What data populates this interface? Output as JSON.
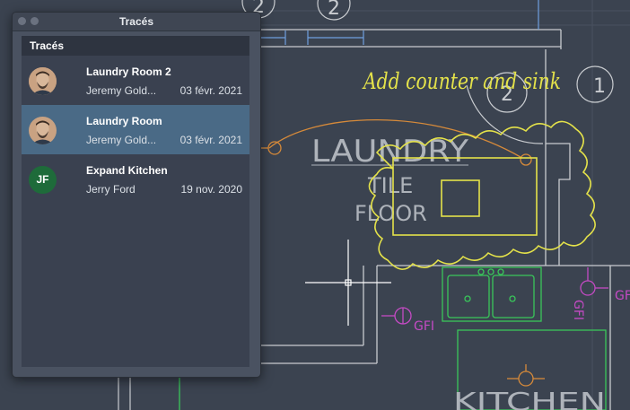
{
  "window": {
    "title": "Tracés"
  },
  "list": {
    "header": "Tracés",
    "items": [
      {
        "title": "Laundry Room 2",
        "author": "Jeremy Gold...",
        "date": "03 févr. 2021",
        "avatar": "photo",
        "selected": false
      },
      {
        "title": "Laundry Room",
        "author": "Jeremy Gold...",
        "date": "03 févr. 2021",
        "avatar": "photo",
        "selected": true
      },
      {
        "title": "Expand Kitchen",
        "author": "Jerry Ford",
        "date": "19 nov. 2020",
        "avatar": "initials",
        "initials": "JF",
        "selected": false
      }
    ]
  },
  "drawing": {
    "markup_note": "Add counter and sink",
    "room_label": "LAUNDRY",
    "floor_label_1": "TILE",
    "floor_label_2": "FLOOR",
    "bottom_label": "KITCHEN",
    "gfi_label": "GFI",
    "gfi_label_vertical": "GFI",
    "gfi_label_right": "GFI",
    "tag_top_1": "2",
    "tag_top_2": "2",
    "tag_right_1": "2",
    "tag_right_2": "1"
  },
  "colors": {
    "background": "#3b4350",
    "markup": "#e4e24a",
    "walls": "#c9ccd0",
    "fixtures": "#39c65a",
    "electrical": "#c44ac4",
    "door": "#d68a3a",
    "selection": "#4a6a86",
    "avatar_initials_bg": "#1e6b3a"
  }
}
